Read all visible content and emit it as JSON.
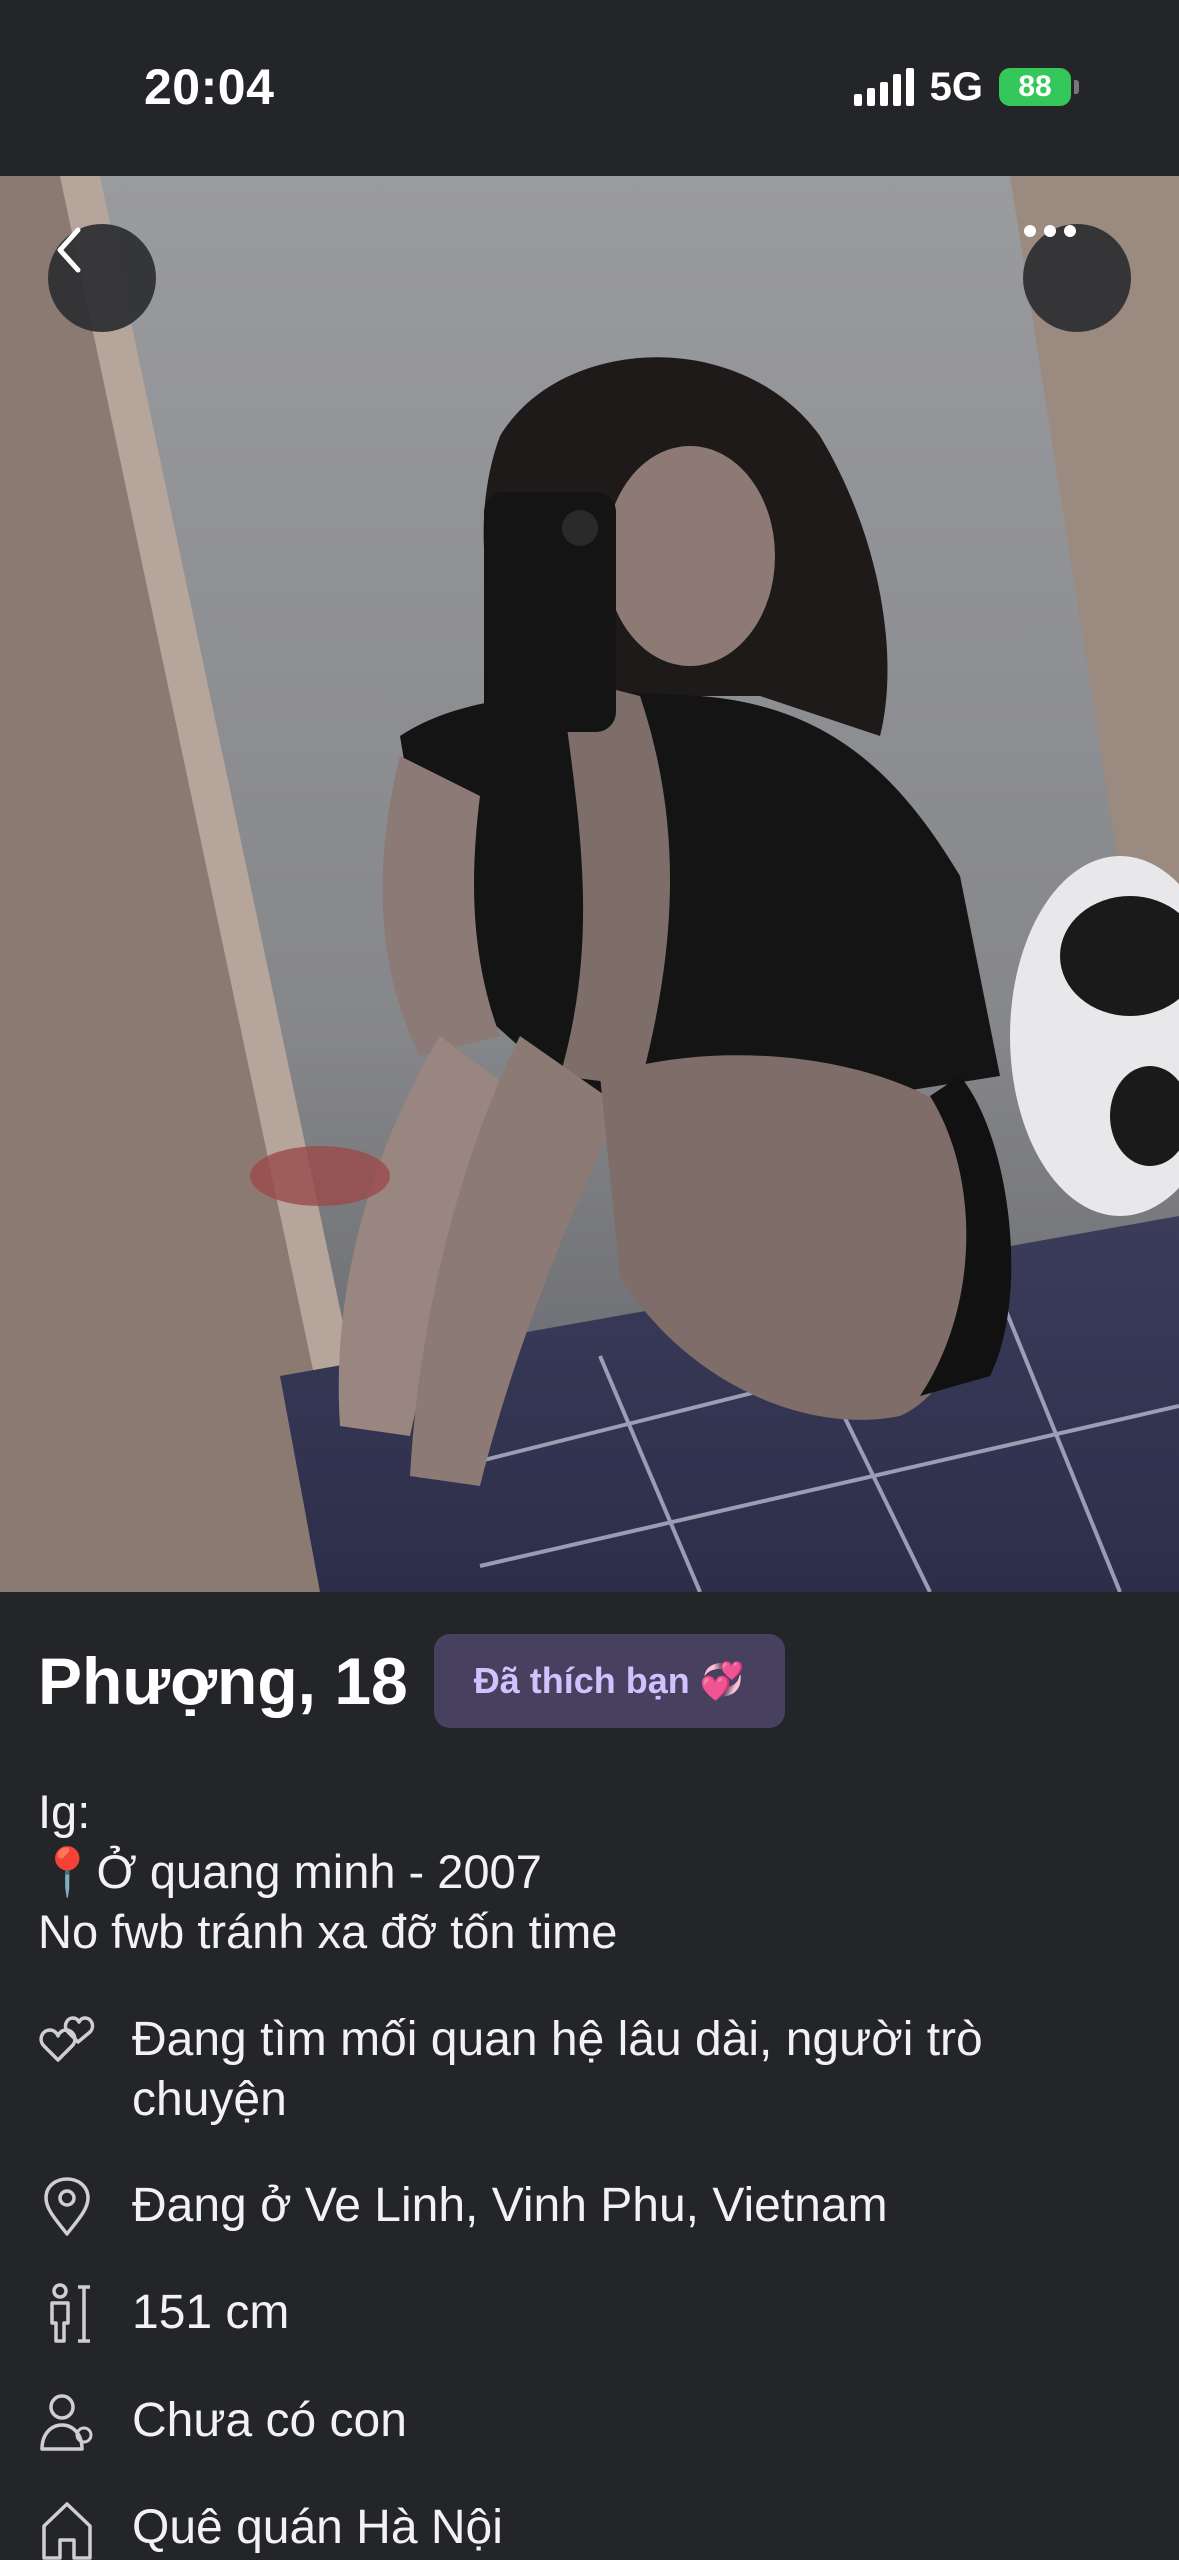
{
  "status_bar": {
    "time": "20:04",
    "network": "5G",
    "battery": "88"
  },
  "profile": {
    "name_age": "Phượng, 18",
    "liked_badge": "Đã thích bạn 💞",
    "bio_lines": [
      "Ig:",
      "📍Ở quang minh - 2007",
      "No fwb tránh xa đỡ tốn time"
    ],
    "details": [
      {
        "icon": "hearts-icon",
        "text": "Đang tìm mối quan hệ lâu dài, người trò chuyện"
      },
      {
        "icon": "location-pin-icon",
        "text": "Đang ở Ve Linh, Vinh Phu, Vietnam"
      },
      {
        "icon": "height-icon",
        "text": "151 cm"
      },
      {
        "icon": "person-icon",
        "text": "Chưa có con"
      },
      {
        "icon": "home-icon",
        "text": "Quê quán Hà Nội"
      }
    ]
  },
  "colors": {
    "background": "#242528",
    "badge_bg": "#47405f",
    "badge_text": "#cfc2ff",
    "battery": "#34c759"
  }
}
